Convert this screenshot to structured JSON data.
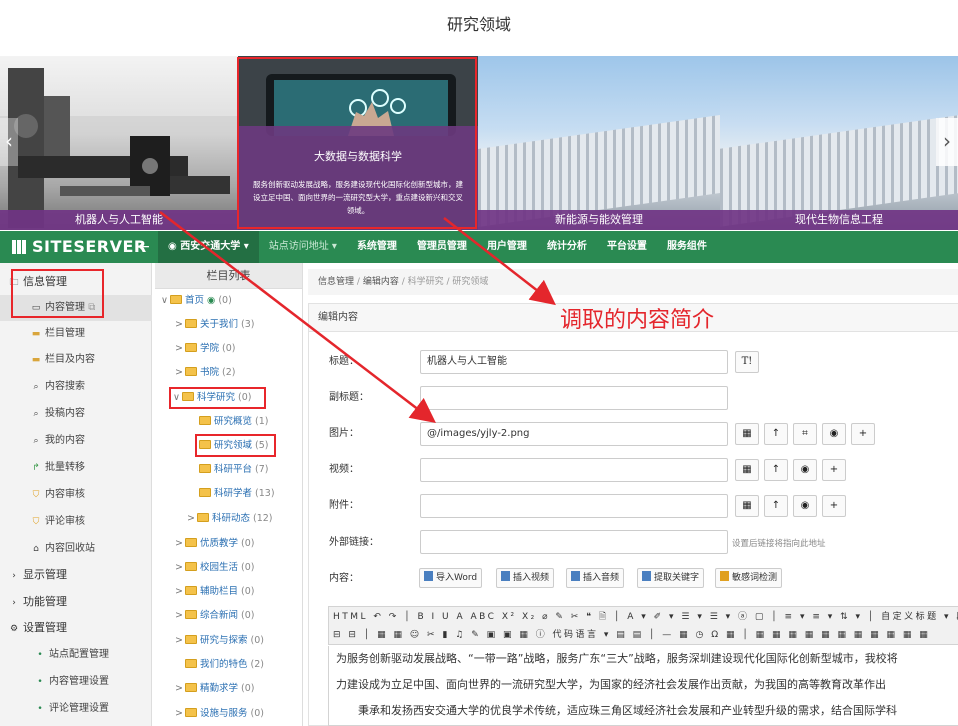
{
  "page_title": "研究领域",
  "banner": {
    "slides": [
      {
        "caption": "机器人与人工智能"
      },
      {
        "title": "大数据与数据科学",
        "description": "服务创新驱动发展战略，服务建设现代化国际化创新型城市，建设立足中国、面向世界的一流研究型大学，重点建设新兴和交叉领域。",
        "icon": "hand-touch-screen"
      },
      {
        "caption": "新能源与能效管理"
      },
      {
        "caption": "现代生物信息工程"
      }
    ],
    "prev_icon": "chevron-left-icon",
    "next_icon": "chevron-right-icon",
    "caption_color": "#703484"
  },
  "header": {
    "brand": "SITESERVER",
    "back_icon": "←",
    "site_name": "西安交通大学 ▾",
    "nav": [
      "站点访问地址 ▾",
      "系统管理",
      "管理员管理",
      "用户管理",
      "统计分析",
      "平台设置",
      "服务组件"
    ],
    "color": "#2a8a52"
  },
  "sidebar": {
    "items": [
      {
        "label": "信息管理",
        "icon": "∨"
      },
      {
        "label": "内容管理",
        "icon": "▭"
      },
      {
        "label": "栏目管理",
        "icon": "▭"
      },
      {
        "label": "栏目及内容",
        "icon": "▭"
      },
      {
        "label": "内容搜索",
        "icon": "🔍"
      },
      {
        "label": "投稿内容",
        "icon": "🔍"
      },
      {
        "label": "我的内容",
        "icon": "🔍"
      },
      {
        "label": "批量转移",
        "icon": "↱"
      },
      {
        "label": "内容审核",
        "icon": "⛉"
      },
      {
        "label": "评论审核",
        "icon": "⛉"
      },
      {
        "label": "内容回收站",
        "icon": "🗑"
      },
      {
        "label": "显示管理",
        "icon": ">"
      },
      {
        "label": "功能管理",
        "icon": ">"
      },
      {
        "label": "设置管理",
        "icon": "∨"
      },
      {
        "label": "站点配置管理",
        "icon": "•"
      },
      {
        "label": "内容管理设置",
        "icon": "•"
      },
      {
        "label": "评论管理设置",
        "icon": "•"
      }
    ]
  },
  "tree": {
    "header": "栏目列表",
    "nodes": [
      {
        "label": "首页",
        "count": "(0)",
        "arrow": "∨"
      },
      {
        "label": "关于我们",
        "count": "(3)",
        "arrow": ">"
      },
      {
        "label": "学院",
        "count": "(0)",
        "arrow": ">"
      },
      {
        "label": "书院",
        "count": "(2)",
        "arrow": ">"
      },
      {
        "label": "科学研究",
        "count": "(0)",
        "arrow": "∨"
      },
      {
        "label": "研究概览",
        "count": "(1)",
        "arrow": ""
      },
      {
        "label": "研究领域",
        "count": "(5)",
        "arrow": ""
      },
      {
        "label": "科研平台",
        "count": "(7)",
        "arrow": ""
      },
      {
        "label": "科研学者",
        "count": "(13)",
        "arrow": ""
      },
      {
        "label": "科研动态",
        "count": "(12)",
        "arrow": ">"
      },
      {
        "label": "优质教学",
        "count": "(0)",
        "arrow": ">"
      },
      {
        "label": "校园生活",
        "count": "(0)",
        "arrow": ">"
      },
      {
        "label": "辅助栏目",
        "count": "(0)",
        "arrow": ">"
      },
      {
        "label": "综合新闻",
        "count": "(0)",
        "arrow": ">"
      },
      {
        "label": "研究与探索",
        "count": "(0)",
        "arrow": ">"
      },
      {
        "label": "我们的特色",
        "count": "(2)",
        "arrow": ""
      },
      {
        "label": "精勤求学",
        "count": "(0)",
        "arrow": ">"
      },
      {
        "label": "设施与服务",
        "count": "(0)",
        "arrow": ">"
      }
    ]
  },
  "breadcrumb": {
    "a": "信息管理",
    "b": "编辑内容",
    "c": "科学研究 / 研究领域"
  },
  "panel_title": "编辑内容",
  "form": {
    "title_label": "标题：",
    "title_value": "机器人与人工智能",
    "title_btn": "T!",
    "subtitle_label": "副标题：",
    "subtitle_value": "",
    "image_label": "图片：",
    "image_value": "@/images/yjly-2.png",
    "video_label": "视频：",
    "video_value": "",
    "attach_label": "附件：",
    "attach_value": "",
    "link_label": "外部链接：",
    "link_value": "",
    "link_hint": "设置后链接将指向此地址",
    "content_label": "内容："
  },
  "content_buttons": [
    "导入Word",
    "插入视频",
    "插入音频",
    "提取关键字",
    "敏感词检测"
  ],
  "editor": {
    "toolbar1": "HTML ↶ ↷ │ B I U A ABC X² X₂ ⌀ ✎ ✂ ❝ 🗎 │ A ▾ ✐ ▾ ☰ ▾ ☰ ▾ ⓐ ▢ │ ≡ ▾ ≡ ▾ ⇅ ▾ │ 自定义标题 ▾  段落",
    "toolbar2": "⊟ ⊟ │ ▦ ▦ ☺ ✂ ▮ ♫ ✎ ▣ ▣ ▦ ⓘ 代码语言 ▾ ▤ ▤ │ — ▦ ◷ Ω ▦ │ ▦ ▦ ▦ ▦ ▦ ▦ ▦ ▦ ▦ ▦ ▦",
    "body_lines": [
      "为服务创新驱动发展战略、“一带一路”战略，服务广东“三大”战略，服务深圳建设现代化国际化创新型城市，我校将",
      "力建设成为立足中国、面向世界的一流研究型大学，为国家的经济社会发展作出贡献，为我国的高等教育改革作出",
      "　　秉承和发扬西安交通大学的优良学术传统，适应珠三角区域经济社会发展和产业转型升级的需求，结合国际学科"
    ]
  },
  "annotation": "调取的内容简介",
  "highlight_color": "#e8262b"
}
